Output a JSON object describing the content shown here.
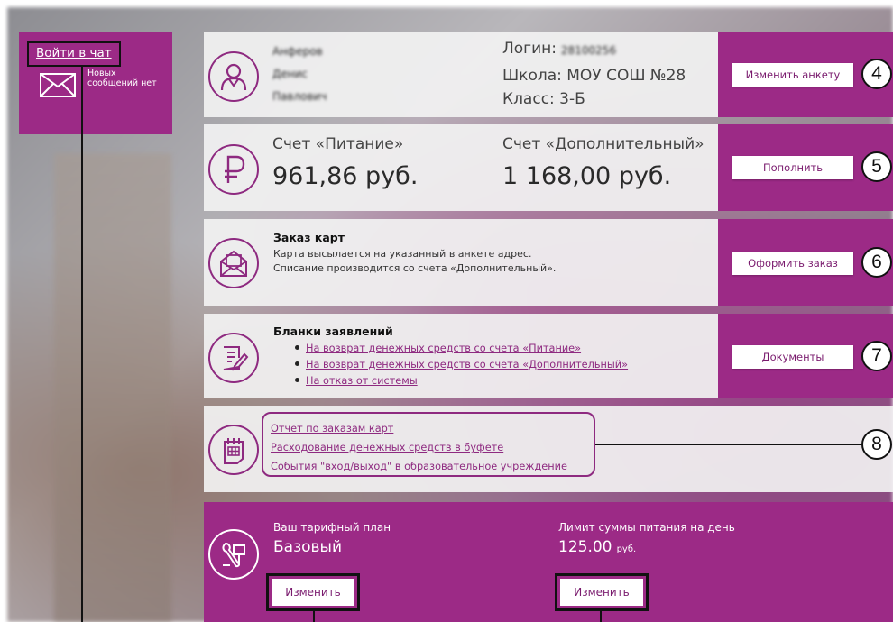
{
  "chat": {
    "link": "Войти в чат",
    "status": "Новых сообщений нет"
  },
  "profile": {
    "surname": "Анферов",
    "name": "Денис",
    "patronymic": "Павлович",
    "login_label": "Логин:",
    "login_value": "28100256",
    "school": "Школа: МОУ СОШ №28",
    "class": "Класс: 3-Б",
    "button": "Изменить анкету",
    "callout": "4"
  },
  "accounts": {
    "food_label": "Счет «Питание»",
    "food_amount": "961,86 руб.",
    "extra_label": "Счет «Дополнительный»",
    "extra_amount": "1 168,00 руб.",
    "button": "Пополнить",
    "callout": "5"
  },
  "cards": {
    "title": "Заказ карт",
    "line1": "Карта высылается на указанный в анкете адрес.",
    "line2": "Списание производится со счета «Дополнительный».",
    "button": "Оформить заказ",
    "callout": "6"
  },
  "forms": {
    "title": "Бланки заявлений",
    "links": [
      "На возврат денежных средств со счета «Питание»",
      "На возврат денежных средств со счета «Дополнительный»",
      "На отказ от системы"
    ],
    "button": "Документы",
    "callout": "7"
  },
  "reports": {
    "links": [
      "Отчет по заказам карт",
      "Расходование денежных средств в буфете",
      "События \"вход/выход\" в образовательное учреждение"
    ],
    "callout": "8"
  },
  "tariff": {
    "plan_label": "Ваш тарифный план",
    "plan_value": "Базовый",
    "limit_label": "Лимит суммы питания на день",
    "limit_value": "125.00",
    "limit_unit": "руб.",
    "change_button": "Изменить"
  },
  "colors": {
    "accent": "#9c2a86",
    "icon": "#8e2a80"
  },
  "icons": [
    "envelope-icon",
    "user-icon",
    "ruble-icon",
    "mail-order-icon",
    "document-edit-icon",
    "calendar-report-icon",
    "tools-icon"
  ]
}
